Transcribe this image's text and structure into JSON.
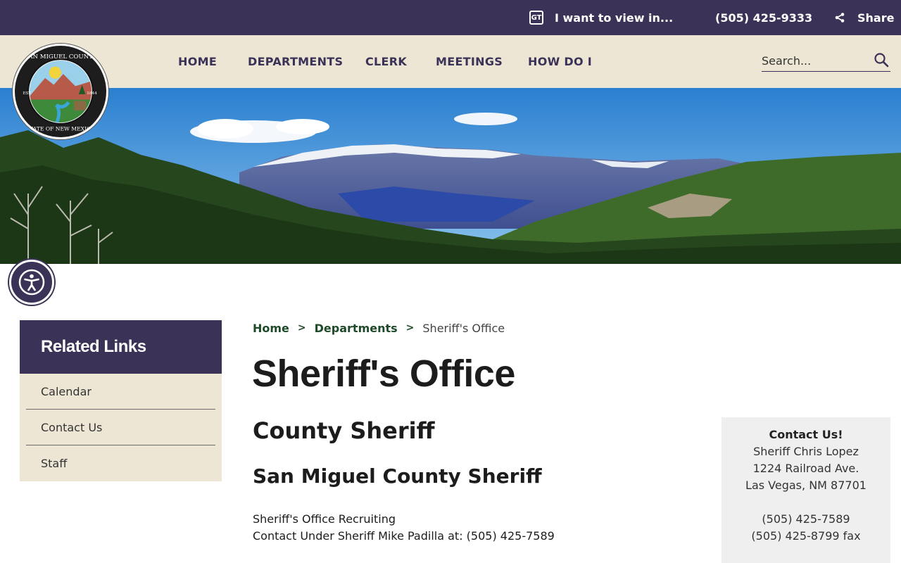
{
  "topbar": {
    "translate_label": "I want to view in...",
    "phone": "(505) 425-9333",
    "share_label": "Share"
  },
  "nav": {
    "items": [
      {
        "label": "HOME"
      },
      {
        "label": "DEPARTMENTS"
      },
      {
        "label": "CLERK"
      },
      {
        "label": "MEETINGS"
      },
      {
        "label": "HOW DO I"
      }
    ]
  },
  "search": {
    "placeholder": "Search..."
  },
  "logo": {
    "text_top": "SAN MIGUEL COUNTY",
    "text_bottom": "STATE OF NEW MEXICO",
    "est": "EST",
    "year": "1844"
  },
  "sidebar": {
    "title": "Related Links",
    "items": [
      {
        "label": "Calendar"
      },
      {
        "label": "Contact Us"
      },
      {
        "label": "Staff"
      }
    ]
  },
  "breadcrumb": {
    "home": "Home",
    "departments": "Departments",
    "current": "Sheriff's Office",
    "separator": ">"
  },
  "main": {
    "title": "Sheriff's Office",
    "subtitle": "County Sheriff",
    "heading": "San Miguel County Sheriff",
    "recruiting": "Sheriff's Office Recruiting",
    "contact_line": "Contact Under Sheriff Mike Padilla at: (505) 425-7589"
  },
  "contact_box": {
    "title": "Contact Us!",
    "name": "Sheriff Chris Lopez",
    "address1": "1224 Railroad Ave.",
    "address2": "Las Vegas, NM 87701",
    "phone": "(505) 425-7589",
    "fax": "(505) 425-8799 fax"
  },
  "colors": {
    "brand_purple": "#3b3257",
    "cream": "#ede6d4",
    "link_green": "#1f4a2a"
  }
}
